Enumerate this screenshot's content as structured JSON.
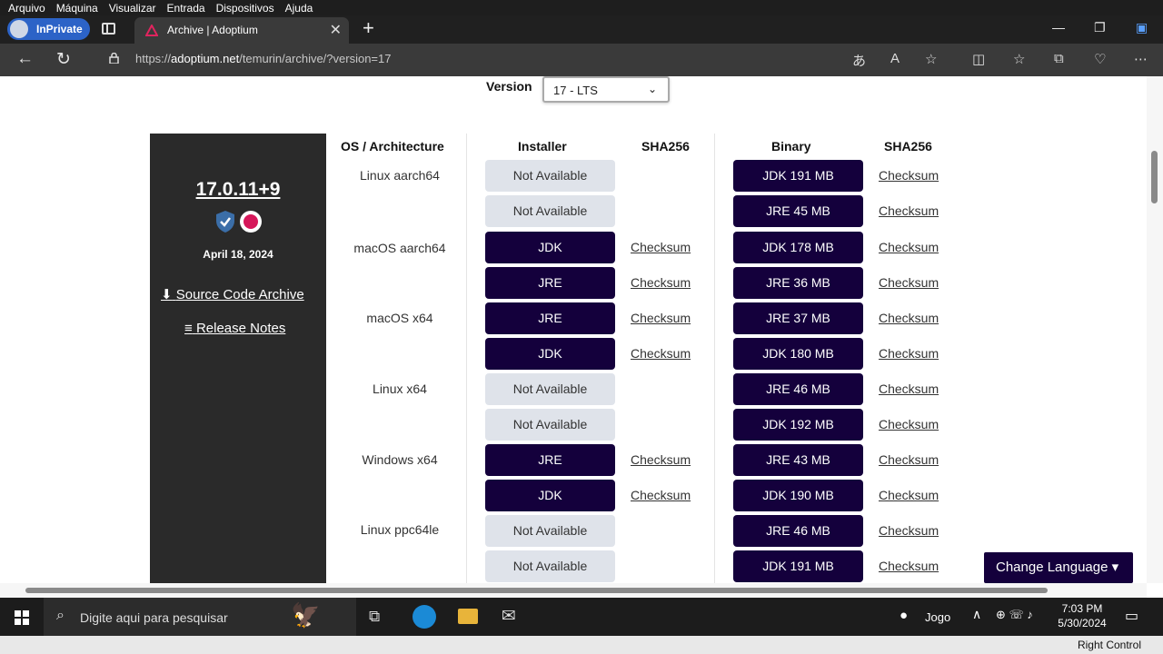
{
  "vm_menu": [
    "Arquivo",
    "Máquina",
    "Visualizar",
    "Entrada",
    "Dispositivos",
    "Ajuda"
  ],
  "browser": {
    "inprivate_label": "InPrivate",
    "tab_title": "Archive | Adoptium",
    "url_prefix": "https://",
    "url_domain": "adoptium.net",
    "url_path": "/temurin/archive/?version=17"
  },
  "page": {
    "version_label": "Version",
    "version_selected": "17 - LTS",
    "release": {
      "name": "17.0.11+9",
      "date": "April 18, 2024",
      "source_link": "Source Code Archive",
      "notes_link": "Release Notes"
    },
    "headers": {
      "os_arch": "OS / Architecture",
      "installer": "Installer",
      "sha_installer": "SHA256",
      "binary": "Binary",
      "sha_binary": "SHA256"
    },
    "os_labels": [
      "Linux aarch64",
      "macOS aarch64",
      "macOS x64",
      "Linux x64",
      "Windows x64",
      "Linux ppc64le"
    ],
    "rows": [
      {
        "installer": "Not Available",
        "installer_available": false,
        "installer_checksum": "",
        "binary": "JDK 191 MB",
        "binary_checksum": "Checksum"
      },
      {
        "installer": "Not Available",
        "installer_available": false,
        "installer_checksum": "",
        "binary": "JRE 45 MB",
        "binary_checksum": "Checksum"
      },
      {
        "installer": "JDK",
        "installer_available": true,
        "installer_checksum": "Checksum",
        "binary": "JDK 178 MB",
        "binary_checksum": "Checksum"
      },
      {
        "installer": "JRE",
        "installer_available": true,
        "installer_checksum": "Checksum",
        "binary": "JRE 36 MB",
        "binary_checksum": "Checksum"
      },
      {
        "installer": "JRE",
        "installer_available": true,
        "installer_checksum": "Checksum",
        "binary": "JRE 37 MB",
        "binary_checksum": "Checksum"
      },
      {
        "installer": "JDK",
        "installer_available": true,
        "installer_checksum": "Checksum",
        "binary": "JDK 180 MB",
        "binary_checksum": "Checksum"
      },
      {
        "installer": "Not Available",
        "installer_available": false,
        "installer_checksum": "",
        "binary": "JRE 46 MB",
        "binary_checksum": "Checksum"
      },
      {
        "installer": "Not Available",
        "installer_available": false,
        "installer_checksum": "",
        "binary": "JDK 192 MB",
        "binary_checksum": "Checksum"
      },
      {
        "installer": "JRE",
        "installer_available": true,
        "installer_checksum": "Checksum",
        "binary": "JRE 43 MB",
        "binary_checksum": "Checksum"
      },
      {
        "installer": "JDK",
        "installer_available": true,
        "installer_checksum": "Checksum",
        "binary": "JDK 190 MB",
        "binary_checksum": "Checksum"
      },
      {
        "installer": "Not Available",
        "installer_available": false,
        "installer_checksum": "",
        "binary": "JRE 46 MB",
        "binary_checksum": "Checksum"
      },
      {
        "installer": "Not Available",
        "installer_available": false,
        "installer_checksum": "",
        "binary": "JDK 191 MB",
        "binary_checksum": "Checksum"
      }
    ],
    "change_language": "Change Language"
  },
  "taskbar": {
    "search_placeholder": "Digite aqui para pesquisar",
    "weather_label": "Jogo",
    "time": "7:03 PM",
    "date": "5/30/2024"
  },
  "vm_status": {
    "host_key": "Right Control"
  },
  "colors": {
    "accent_dark": "#14003c",
    "not_available": "#dfe3ea",
    "side_panel": "#2a2a2a",
    "edge_accent": "#2c63c7"
  }
}
